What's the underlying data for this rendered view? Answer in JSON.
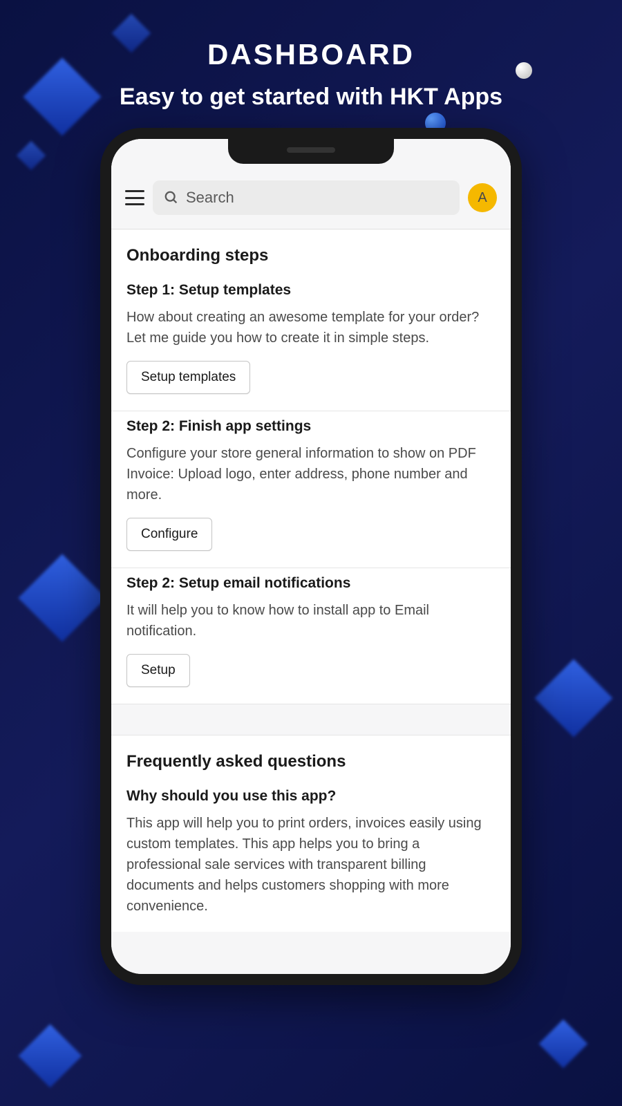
{
  "promo": {
    "title": "DASHBOARD",
    "subtitle": "Easy to get started with HKT Apps"
  },
  "topbar": {
    "search_placeholder": "Search",
    "avatar_letter": "A"
  },
  "onboarding": {
    "heading": "Onboarding steps",
    "steps": [
      {
        "title": "Step 1: Setup templates",
        "description": "How about creating an awesome template for your order? Let me guide you how to create it in simple steps.",
        "button": "Setup templates"
      },
      {
        "title": "Step 2: Finish app settings",
        "description": "Configure your store general information to show on PDF Invoice: Upload logo, enter address, phone number and more.",
        "button": "Configure"
      },
      {
        "title": "Step 2: Setup email notifications",
        "description": "It will help you to know how to install app to Email notification.",
        "button": "Setup"
      }
    ]
  },
  "faq": {
    "heading": "Frequently asked questions",
    "items": [
      {
        "question": "Why should you use this app?",
        "answer": "This app will help you to print orders, invoices easily using custom templates. This app helps you to bring a professional sale services with transparent billing documents and helps customers shopping with more convenience."
      }
    ]
  }
}
